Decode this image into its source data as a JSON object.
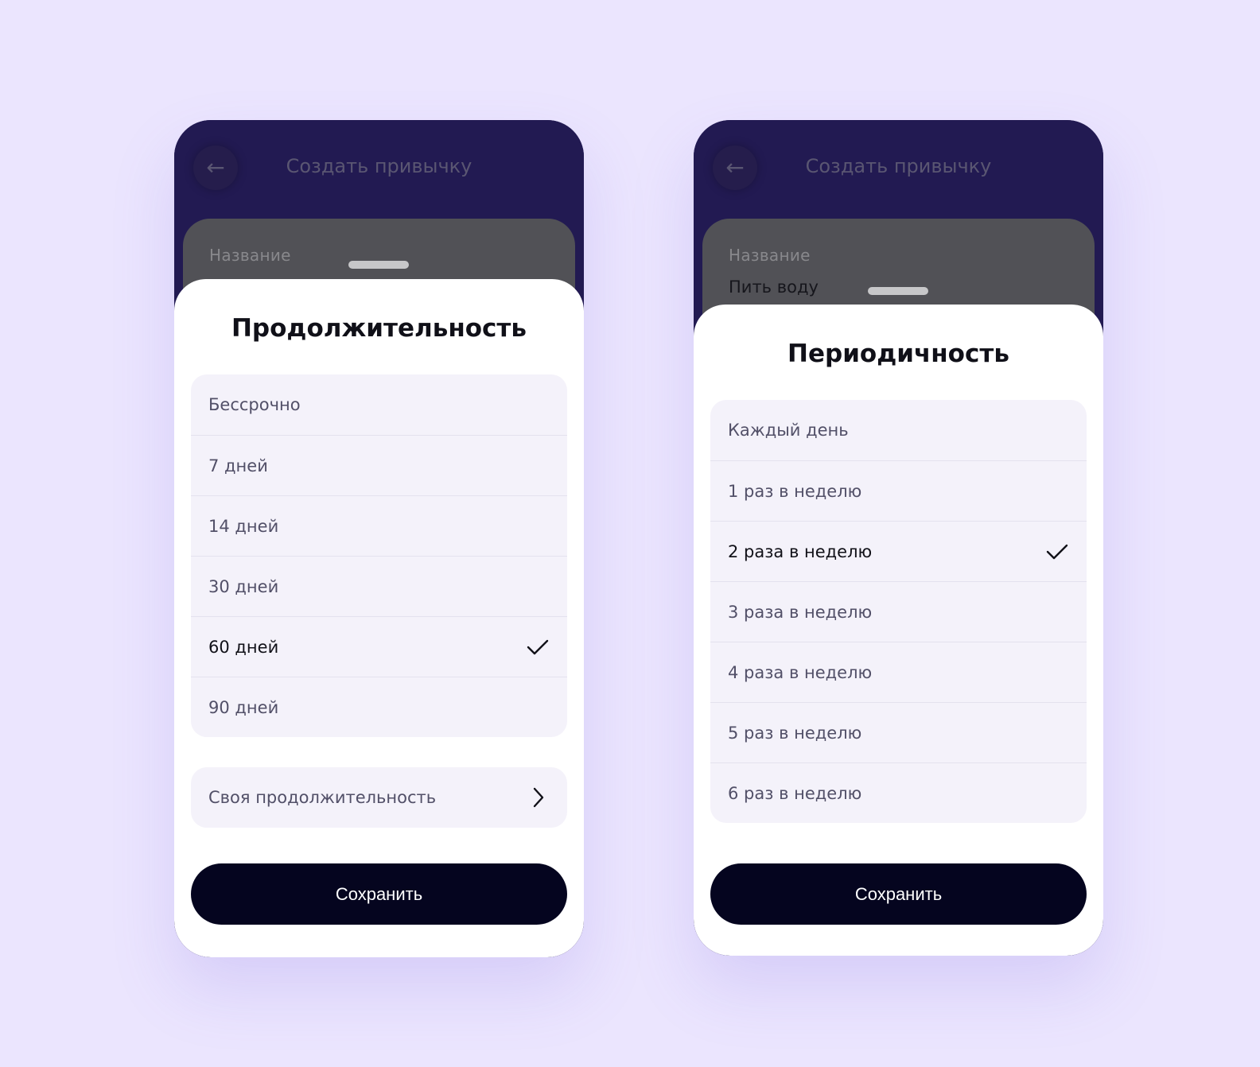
{
  "screens": [
    {
      "header_title": "Создать привычку",
      "back_icon": "arrow-left-icon",
      "field_label": "Название",
      "sheet_title": "Продолжительность",
      "options": [
        {
          "label": "Бессрочно",
          "selected": false
        },
        {
          "label": "7 дней",
          "selected": false
        },
        {
          "label": "14 дней",
          "selected": false
        },
        {
          "label": "30 дней",
          "selected": false
        },
        {
          "label": "60 дней",
          "selected": true
        },
        {
          "label": "90 дней",
          "selected": false
        }
      ],
      "custom_option": "Своя продолжительность",
      "save_label": "Сохранить"
    },
    {
      "header_title": "Создать привычку",
      "back_icon": "arrow-left-icon",
      "field_label": "Название",
      "field_value": "Пить воду",
      "sheet_title": "Периодичность",
      "options": [
        {
          "label": "Каждый день",
          "selected": false
        },
        {
          "label": "1 раз в неделю",
          "selected": false
        },
        {
          "label": "2 раза в неделю",
          "selected": true
        },
        {
          "label": "3 раза в неделю",
          "selected": false
        },
        {
          "label": "4 раза в неделю",
          "selected": false
        },
        {
          "label": "5 раз в неделю",
          "selected": false
        },
        {
          "label": "6 раз в неделю",
          "selected": false
        }
      ],
      "save_label": "Сохранить"
    }
  ],
  "colors": {
    "background": "#ebe5fe",
    "header": "#221a52",
    "button": "#05051f",
    "option_bg": "#f4f2fa"
  }
}
